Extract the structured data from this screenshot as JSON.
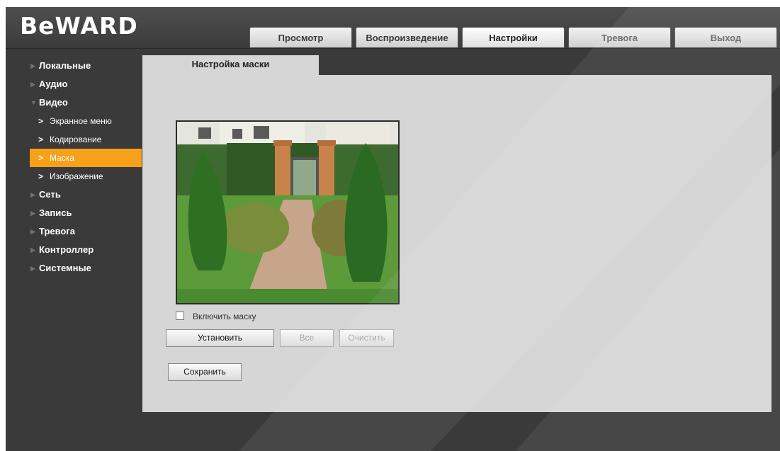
{
  "brand": {
    "logo_text": "BeWARD"
  },
  "tabs": [
    {
      "label": "Просмотр"
    },
    {
      "label": "Воспроизведение"
    },
    {
      "label": "Настройки"
    },
    {
      "label": "Тревога"
    },
    {
      "label": "Выход"
    }
  ],
  "sidebar": {
    "items": [
      {
        "label": "Локальные"
      },
      {
        "label": "Аудио"
      },
      {
        "label": "Видео"
      },
      {
        "label": "Сеть"
      },
      {
        "label": "Запись"
      },
      {
        "label": "Тревога"
      },
      {
        "label": "Контроллер"
      },
      {
        "label": "Системные"
      }
    ],
    "video_sub": [
      {
        "label": "Экранное меню"
      },
      {
        "label": "Кодирование"
      },
      {
        "label": "Маска"
      },
      {
        "label": "Изображение"
      }
    ]
  },
  "panel": {
    "tab_title": "Настройка маски",
    "enable_mask_label": "Включить маску",
    "enable_mask_checked": false,
    "buttons": {
      "set": "Установить",
      "all": "Все",
      "clear": "Очистить",
      "save": "Сохранить"
    }
  },
  "colors": {
    "accent": "#f5a11a",
    "panel_bg": "#d6d6d6",
    "frame_bg": "#3a3a3a"
  },
  "icons": {
    "collapsed": "triangle-right-icon",
    "expanded": "triangle-down-icon",
    "subitem": "chevron-right-icon"
  }
}
